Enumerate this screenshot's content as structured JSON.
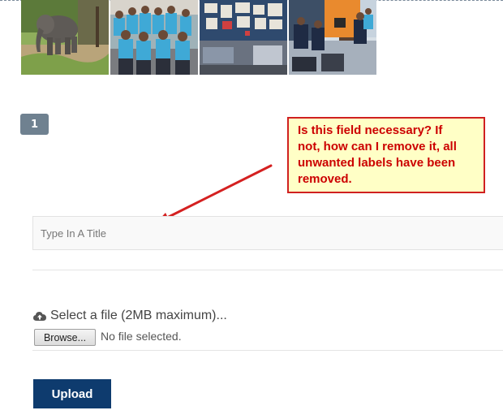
{
  "gallery": {
    "thumbnails": [
      {
        "icon": "elephant-photo"
      },
      {
        "icon": "group-of-students-photo"
      },
      {
        "icon": "classroom-wall-photo"
      },
      {
        "icon": "students-at-computers-photo"
      }
    ]
  },
  "pagination": {
    "current_page": "1"
  },
  "callout": {
    "lines": [
      "Is this field necessary? If",
      "not, how can I remove it, all",
      "unwanted labels have been",
      "removed."
    ],
    "text_color": "#cc0000",
    "border_color": "#d02020",
    "background_color": "#ffffc6"
  },
  "form": {
    "title_field": {
      "placeholder": "Type In A Title",
      "value": ""
    },
    "file_section": {
      "icon": "cloud-upload-icon",
      "label": "Select a file (2MB maximum)...",
      "browse_label": "Browse...",
      "file_status": "No file selected."
    },
    "upload_label": "Upload",
    "upload_color": "#0e3b6e"
  }
}
